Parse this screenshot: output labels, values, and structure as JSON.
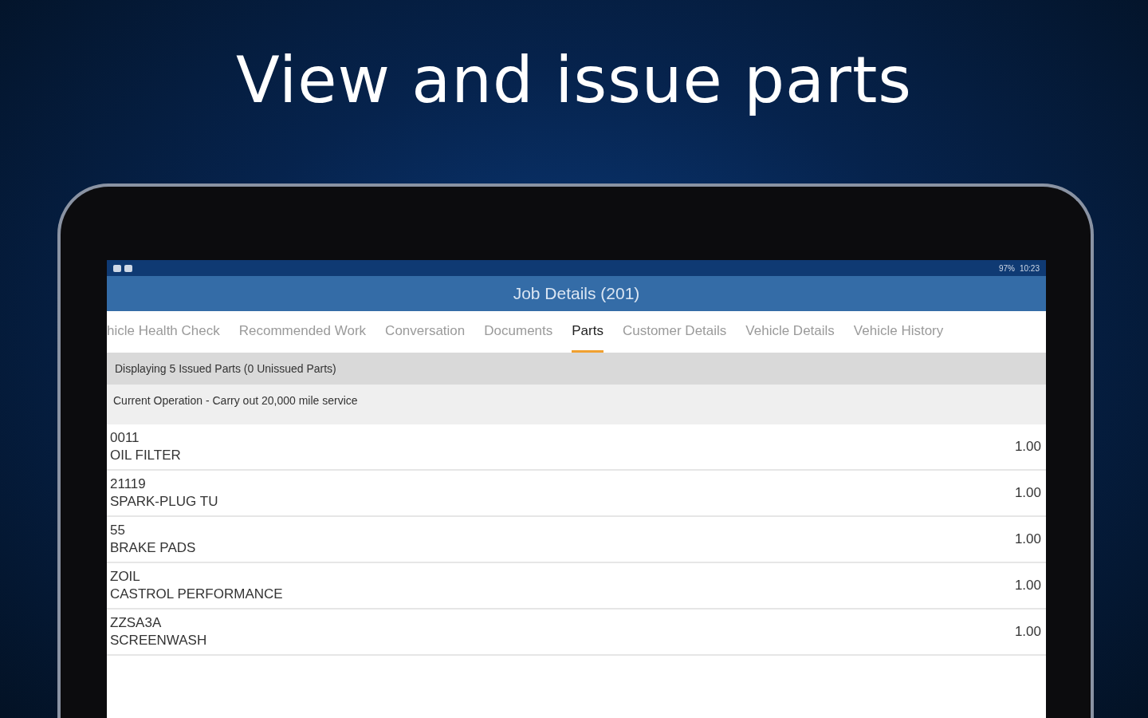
{
  "headline": "View and issue parts",
  "status_bar": {
    "battery": "97%",
    "time": "10:23"
  },
  "app_bar": {
    "title": "Job Details (201)"
  },
  "tabs": [
    {
      "label": "hicle Health Check",
      "selected": false
    },
    {
      "label": "Recommended Work",
      "selected": false
    },
    {
      "label": "Conversation",
      "selected": false
    },
    {
      "label": "Documents",
      "selected": false
    },
    {
      "label": "Parts",
      "selected": true
    },
    {
      "label": "Customer Details",
      "selected": false
    },
    {
      "label": "Vehicle Details",
      "selected": false
    },
    {
      "label": "Vehicle History",
      "selected": false
    }
  ],
  "summary": "Displaying 5 Issued Parts  (0 Unissued Parts)",
  "operation": "Current Operation - Carry out 20,000 mile service",
  "parts": [
    {
      "code": "0011",
      "name": "OIL FILTER",
      "quantity": "1.00"
    },
    {
      "code": "21119",
      "name": "SPARK-PLUG TU",
      "quantity": "1.00"
    },
    {
      "code": "55",
      "name": "BRAKE PADS",
      "quantity": "1.00"
    },
    {
      "code": "ZOIL",
      "name": "CASTROL PERFORMANCE",
      "quantity": "1.00"
    },
    {
      "code": "ZZSA3A",
      "name": "SCREENWASH",
      "quantity": "1.00"
    }
  ]
}
